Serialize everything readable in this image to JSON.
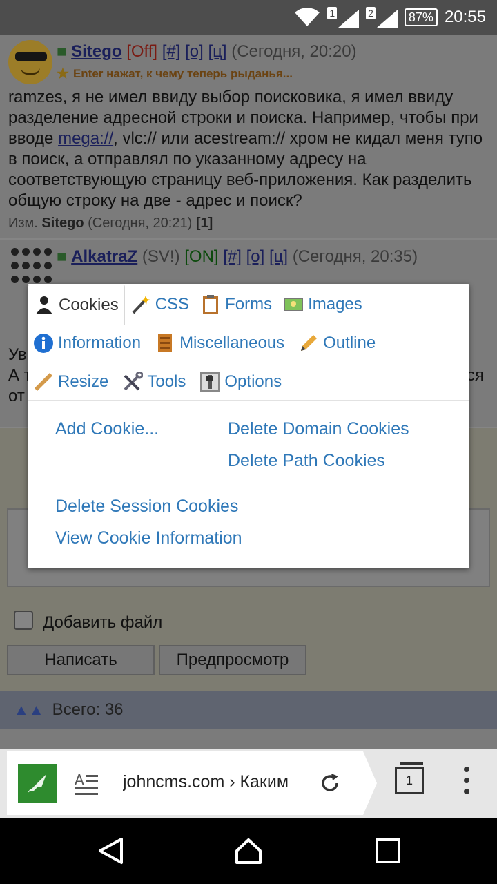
{
  "status_bar": {
    "sim1": "1",
    "sim2": "2",
    "battery": "87%",
    "time": "20:55"
  },
  "post1": {
    "username": "Sitego",
    "state": "[Off]",
    "links": [
      "[#]",
      "[o]",
      "[ц]"
    ],
    "time": "(Сегодня, 20:20)",
    "user_status": "Enter нажат, к чему теперь рыданья...",
    "text_a": "ramzes, я не имел ввиду выбор поисковика, я имел ввиду разделение адресной строки и поиска. Например, чтобы при вводе ",
    "text_link": "mega://",
    "text_b": ", vlc:// или acestream:// хром не кидал меня тупо в поиск, а отправлял по указанному адресу на соответствующую страницу веб-приложения. Как разделить общую строку на две - адрес и поиск?",
    "edit_prefix": "Изм.",
    "edit_user": "Sitego",
    "edit_time": "(Сегодня, 20:21)",
    "edit_count": "[1]"
  },
  "post2": {
    "username": "AlkatraZ",
    "tag": "(SV!)",
    "state": "[ON]",
    "links": [
      "[#]",
      "[o]",
      "[ц]"
    ],
    "time": "(Сегодня, 20:35)",
    "partial_1": "Ув",
    "partial_2": "А т",
    "partial_3": "от",
    "partial_right": "ся"
  },
  "reply": {
    "attach_label": "Добавить файл",
    "write_button": "Написать",
    "preview_button": "Предпросмотр"
  },
  "total": {
    "label": "Всего: 36"
  },
  "popup": {
    "tabs": [
      {
        "label": "Cookies",
        "icon": "cookie-person-icon"
      },
      {
        "label": "CSS",
        "icon": "magic-wand-icon"
      },
      {
        "label": "Forms",
        "icon": "clipboard-icon"
      },
      {
        "label": "Images",
        "icon": "picture-icon"
      },
      {
        "label": "Information",
        "icon": "info-icon"
      },
      {
        "label": "Miscellaneous",
        "icon": "box-icon"
      },
      {
        "label": "Outline",
        "icon": "pencil-icon"
      },
      {
        "label": "Resize",
        "icon": "ruler-icon"
      },
      {
        "label": "Tools",
        "icon": "tools-icon"
      },
      {
        "label": "Options",
        "icon": "switch-icon"
      }
    ],
    "actions": {
      "add_cookie": "Add Cookie...",
      "delete_domain": "Delete Domain Cookies",
      "delete_path": "Delete Path Cookies",
      "delete_session": "Delete Session Cookies",
      "view_info": "View Cookie Information"
    }
  },
  "browser": {
    "url": "johncms.com › Каким",
    "tab_count": "1"
  },
  "colors": {
    "link_blue": "#2f78b8",
    "site_icon_green": "#2e8b2e"
  }
}
